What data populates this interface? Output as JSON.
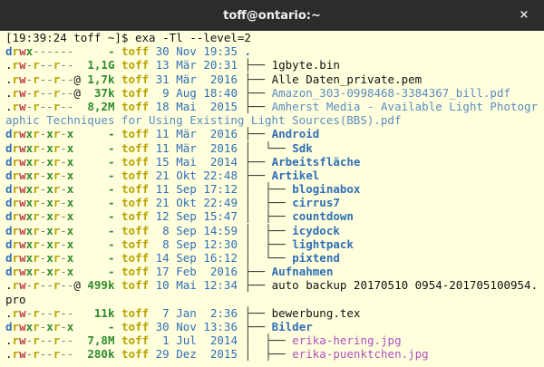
{
  "window": {
    "title": "toff@ontario:~",
    "close_glyph": "×"
  },
  "prompt": "[19:39:24 toff ~]$ exa -Tl --level=2",
  "rows": [
    {
      "perm": "drwx------",
      "at": "",
      "size": "-",
      "user": "toff",
      "date": "30 Nov 19:35",
      "tree": "",
      "name": ".",
      "kind": "dir"
    },
    {
      "perm": ".rw-r--r--",
      "at": "",
      "size": "1,1G",
      "user": "toff",
      "date": "13 Mär 20:31",
      "tree": "├── ",
      "name": "1gbyte.bin",
      "kind": "file"
    },
    {
      "perm": ".rw-r--r--",
      "at": "@",
      "size": "1,7k",
      "user": "toff",
      "date": "31 Mär  2016",
      "tree": "├── ",
      "name": "Alle Daten_private.pem",
      "kind": "file"
    },
    {
      "perm": ".rw-r--r--",
      "at": "@",
      "size": "37k",
      "user": "toff",
      "date": " 9 Aug 18:40",
      "tree": "├── ",
      "name": "Amazon_303-0998468-3384367_bill.pdf",
      "kind": "doc"
    },
    {
      "perm": ".rw-r--r--",
      "at": "",
      "size": "8,2M",
      "user": "toff",
      "date": "18 Mai  2015",
      "tree": "├── ",
      "name": "Amherst Media - Available Light Photographic Techniques for Using Existing Light Sources(BBS).pdf",
      "kind": "doc",
      "wrap": true
    },
    {
      "perm": "drwxr-xr-x",
      "at": "",
      "size": "-",
      "user": "toff",
      "date": "11 Mär  2016",
      "tree": "├── ",
      "name": "Android",
      "kind": "dir"
    },
    {
      "perm": "drwxr-xr-x",
      "at": "",
      "size": "-",
      "user": "toff",
      "date": "11 Mär  2016",
      "tree": "│  └── ",
      "name": "Sdk",
      "kind": "dir"
    },
    {
      "perm": "drwxr-xr-x",
      "at": "",
      "size": "-",
      "user": "toff",
      "date": "15 Mai  2014",
      "tree": "├── ",
      "name": "Arbeitsfläche",
      "kind": "dir"
    },
    {
      "perm": "drwxr-xr-x",
      "at": "",
      "size": "-",
      "user": "toff",
      "date": "21 Okt 22:48",
      "tree": "├── ",
      "name": "Artikel",
      "kind": "dir"
    },
    {
      "perm": "drwxr-xr-x",
      "at": "",
      "size": "-",
      "user": "toff",
      "date": "11 Sep 17:12",
      "tree": "│  ├── ",
      "name": "bloginabox",
      "kind": "dir"
    },
    {
      "perm": "drwxr-xr-x",
      "at": "",
      "size": "-",
      "user": "toff",
      "date": "21 Okt 22:49",
      "tree": "│  ├── ",
      "name": "cirrus7",
      "kind": "dir"
    },
    {
      "perm": "drwxr-xr-x",
      "at": "",
      "size": "-",
      "user": "toff",
      "date": "12 Sep 15:47",
      "tree": "│  ├── ",
      "name": "countdown",
      "kind": "dir"
    },
    {
      "perm": "drwxr-xr-x",
      "at": "",
      "size": "-",
      "user": "toff",
      "date": " 8 Sep 14:59",
      "tree": "│  ├── ",
      "name": "icydock",
      "kind": "dir"
    },
    {
      "perm": "drwxr-xr-x",
      "at": "",
      "size": "-",
      "user": "toff",
      "date": " 8 Sep 12:30",
      "tree": "│  ├── ",
      "name": "lightpack",
      "kind": "dir"
    },
    {
      "perm": "drwxr-xr-x",
      "at": "",
      "size": "-",
      "user": "toff",
      "date": "14 Sep 16:12",
      "tree": "│  └── ",
      "name": "pixtend",
      "kind": "dir"
    },
    {
      "perm": "drwxr-xr-x",
      "at": "",
      "size": "-",
      "user": "toff",
      "date": "17 Feb  2016",
      "tree": "├── ",
      "name": "Aufnahmen",
      "kind": "dir"
    },
    {
      "perm": ".rw-r--r--",
      "at": "@",
      "size": "499k",
      "user": "toff",
      "date": "10 Mai 12:34",
      "tree": "├── ",
      "name": "auto backup 20170510 0954-201705100954.pro",
      "kind": "file",
      "wrap": true
    },
    {
      "perm": ".rw-r--r--",
      "at": "",
      "size": "11k",
      "user": "toff",
      "date": " 7 Jan  2:36",
      "tree": "├── ",
      "name": "bewerbung.tex",
      "kind": "file"
    },
    {
      "perm": "drwxr-xr-x",
      "at": "",
      "size": "-",
      "user": "toff",
      "date": "30 Nov 13:36",
      "tree": "├── ",
      "name": "Bilder",
      "kind": "dir"
    },
    {
      "perm": ".rw-r--r--",
      "at": "",
      "size": "7,8M",
      "user": "toff",
      "date": " 1 Jul  2014",
      "tree": "│  ├── ",
      "name": "erika-hering.jpg",
      "kind": "img"
    },
    {
      "perm": ".rw-r--r--",
      "at": "",
      "size": "280k",
      "user": "toff",
      "date": "29 Dez  2015",
      "tree": "│  ├── ",
      "name": "erika-puenktchen.jpg",
      "kind": "img"
    }
  ]
}
